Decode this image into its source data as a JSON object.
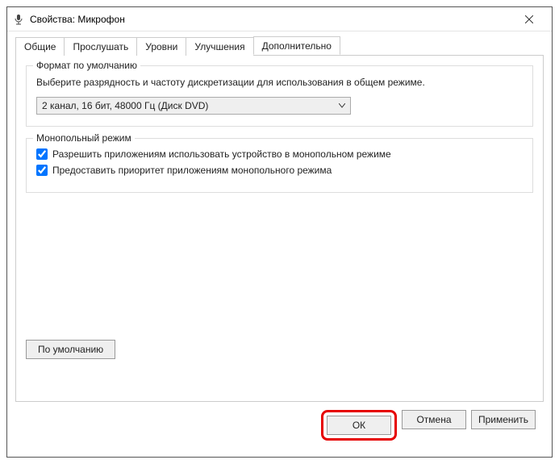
{
  "titlebar": {
    "title": "Свойства: Микрофон"
  },
  "tabs": {
    "general": "Общие",
    "listen": "Прослушать",
    "levels": "Уровни",
    "enhancements": "Улучшения",
    "advanced": "Дополнительно"
  },
  "format_group": {
    "legend": "Формат по умолчанию",
    "description": "Выберите разрядность и частоту дискретизации для использования в общем режиме.",
    "selected": "2 канал, 16 бит, 48000 Гц (Диск DVD)"
  },
  "exclusive_group": {
    "legend": "Монопольный режим",
    "allow_exclusive": "Разрешить приложениям использовать устройство в монопольном режиме",
    "priority_exclusive": "Предоставить приоритет приложениям монопольного режима"
  },
  "defaults_button": "По умолчанию",
  "buttons": {
    "ok": "ОК",
    "cancel": "Отмена",
    "apply": "Применить"
  }
}
